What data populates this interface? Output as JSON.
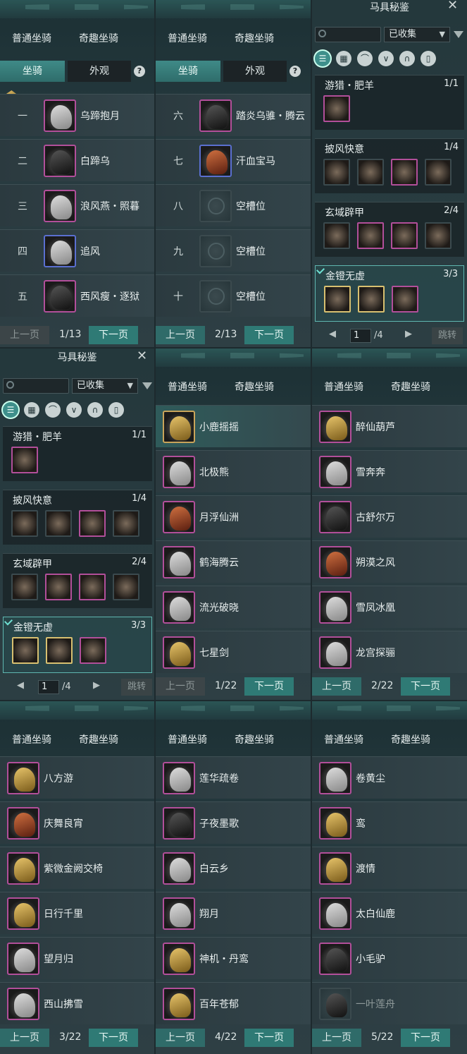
{
  "ride_list_tabs": {
    "normal": "普通坐骑",
    "fun": "奇趣坐骑"
  },
  "subtabs": {
    "mount": "坐骑",
    "appearance": "外观",
    "help": "?"
  },
  "pager": {
    "prev": "上一页",
    "next": "下一页"
  },
  "panel1": {
    "page": "1/13",
    "rows": [
      {
        "num": "一",
        "name": "乌蹄抱月"
      },
      {
        "num": "二",
        "name": "白蹄乌"
      },
      {
        "num": "三",
        "name": "浪风燕・照暮"
      },
      {
        "num": "四",
        "name": "追风"
      },
      {
        "num": "五",
        "name": "西风瘦・逐狱"
      }
    ]
  },
  "panel2": {
    "page": "2/13",
    "rows": [
      {
        "num": "六",
        "name": "踏炎乌骓・腾云"
      },
      {
        "num": "七",
        "name": "汗血宝马"
      },
      {
        "num": "八",
        "name": "空槽位"
      },
      {
        "num": "九",
        "name": "空槽位"
      },
      {
        "num": "十",
        "name": "空槽位"
      }
    ]
  },
  "saddle": {
    "title": "马具秘鉴",
    "filter": "已收集",
    "jump": "跳转",
    "page_current": "1",
    "page_total": "/4",
    "sets": [
      {
        "name": "游猎・肥羊",
        "count": "1/1"
      },
      {
        "name": "披风快意",
        "count": "1/4"
      },
      {
        "name": "玄域辟甲",
        "count": "2/4"
      },
      {
        "name": "金镫无虚",
        "count": "3/3"
      }
    ],
    "category_icons": [
      "list-icon",
      "grid-icon",
      "saddle-icon",
      "horn-icon",
      "horseshoe-icon",
      "shield-icon"
    ]
  },
  "fun_p1": {
    "page": "1/22",
    "items": [
      "小鹿摇摇",
      "北极熊",
      "月浮仙洲",
      "鹤海腾云",
      "流光破晓",
      "七星剑"
    ]
  },
  "fun_p2": {
    "page": "2/22",
    "items": [
      "醉仙葫芦",
      "雪奔奔",
      "古舒尔万",
      "朔漠之风",
      "雪凤冰凰",
      "龙宫探骊"
    ]
  },
  "fun_p3": {
    "page": "3/22",
    "items": [
      "八方游",
      "庆舞良宵",
      "紫微金阙交椅",
      "日行千里",
      "望月归",
      "西山拂雪"
    ]
  },
  "fun_p4": {
    "page": "4/22",
    "items": [
      "莲华疏卷",
      "子夜墨歌",
      "白云乡",
      "翔月",
      "神机・丹鸾",
      "百年苍郁"
    ]
  },
  "fun_p5": {
    "page": "5/22",
    "items": [
      "卷黄尘",
      "鸾",
      "渡情",
      "太白仙鹿",
      "小毛驴",
      "一叶莲舟"
    ]
  }
}
